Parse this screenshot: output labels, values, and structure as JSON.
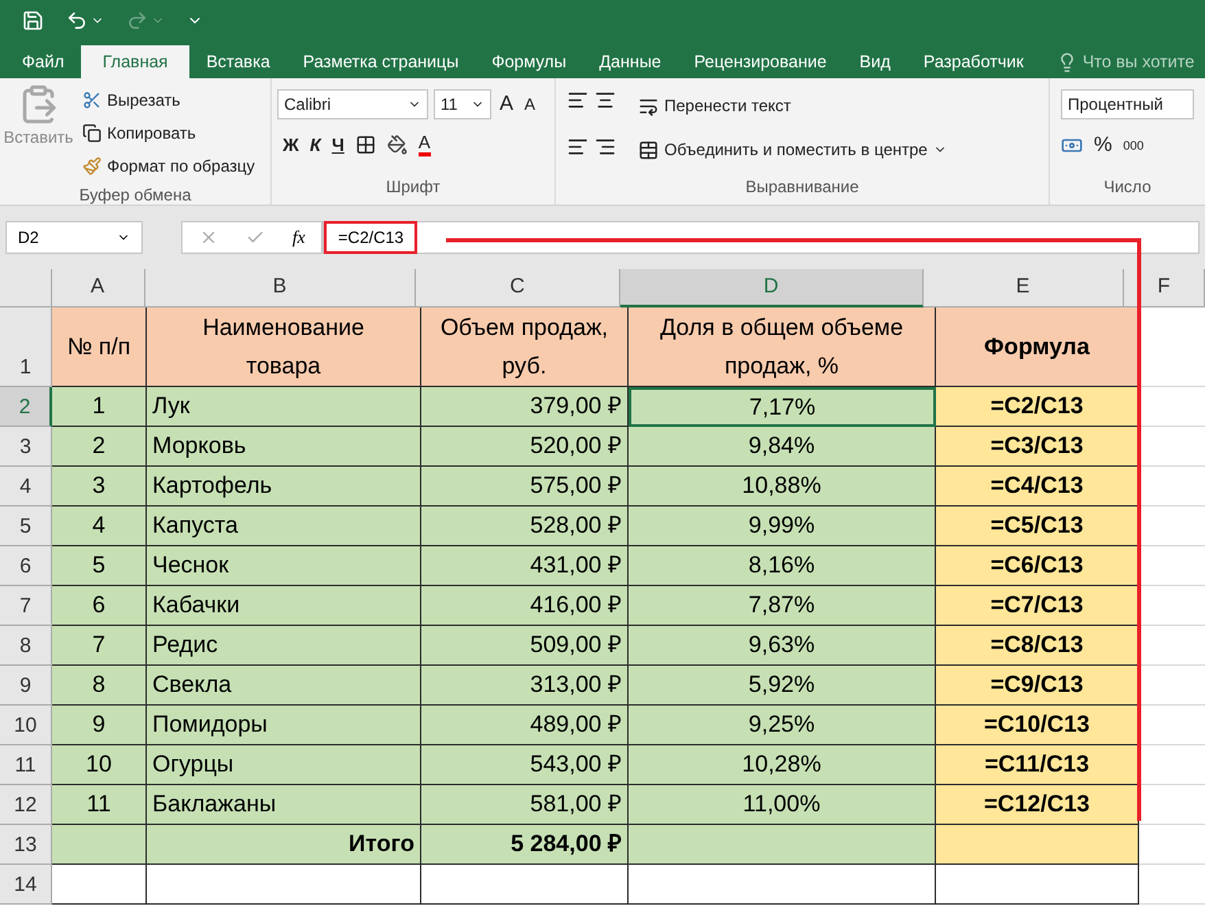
{
  "tabs": [
    {
      "label": "Файл",
      "selected": false
    },
    {
      "label": "Главная",
      "selected": true
    },
    {
      "label": "Вставка",
      "selected": false
    },
    {
      "label": "Разметка страницы",
      "selected": false
    },
    {
      "label": "Формулы",
      "selected": false
    },
    {
      "label": "Данные",
      "selected": false
    },
    {
      "label": "Рецензирование",
      "selected": false
    },
    {
      "label": "Вид",
      "selected": false
    },
    {
      "label": "Разработчик",
      "selected": false
    }
  ],
  "search_hint": "Что вы хотите",
  "clipboard": {
    "paste": "Вставить",
    "cut": "Вырезать",
    "copy": "Копировать",
    "format_painter": "Формат по образцу",
    "label": "Буфер обмена"
  },
  "font": {
    "name": "Calibri",
    "size": "11",
    "grow": "A",
    "shrink": "A",
    "bold": "Ж",
    "italic": "К",
    "underline": "Ч",
    "font_color": "A",
    "label": "Шрифт"
  },
  "alignment": {
    "wrap": "Перенести текст",
    "merge": "Объединить и поместить в центре",
    "label": "Выравнивание"
  },
  "number": {
    "format": "Процентный",
    "percent": "%",
    "thousands": "000",
    "label": "Число"
  },
  "formula_bar": {
    "name_box": "D2",
    "fx": "fx",
    "formula": "=C2/C13"
  },
  "sheet": {
    "columns": [
      {
        "label": "A",
        "selected": false
      },
      {
        "label": "B",
        "selected": false
      },
      {
        "label": "C",
        "selected": false
      },
      {
        "label": "D",
        "selected": true
      },
      {
        "label": "E",
        "selected": false
      },
      {
        "label": "F",
        "selected": false
      }
    ],
    "rows": [
      {
        "number": "1",
        "kind": "header",
        "selected": false,
        "cells": [
          "№ п/п",
          "Наименование товара",
          "Объем продаж, руб.",
          "Доля в общем объеме продаж, %",
          "Формула"
        ]
      },
      {
        "number": "2",
        "kind": "data",
        "selected": true,
        "cells": [
          "1",
          "Лук",
          "379,00 ₽",
          "7,17%",
          "=C2/C13"
        ]
      },
      {
        "number": "3",
        "kind": "data",
        "selected": false,
        "cells": [
          "2",
          "Морковь",
          "520,00 ₽",
          "9,84%",
          "=C3/C13"
        ]
      },
      {
        "number": "4",
        "kind": "data",
        "selected": false,
        "cells": [
          "3",
          "Картофель",
          "575,00 ₽",
          "10,88%",
          "=C4/C13"
        ]
      },
      {
        "number": "5",
        "kind": "data",
        "selected": false,
        "cells": [
          "4",
          "Капуста",
          "528,00 ₽",
          "9,99%",
          "=C5/C13"
        ]
      },
      {
        "number": "6",
        "kind": "data",
        "selected": false,
        "cells": [
          "5",
          "Чеснок",
          "431,00 ₽",
          "8,16%",
          "=C6/C13"
        ]
      },
      {
        "number": "7",
        "kind": "data",
        "selected": false,
        "cells": [
          "6",
          "Кабачки",
          "416,00 ₽",
          "7,87%",
          "=C7/C13"
        ]
      },
      {
        "number": "8",
        "kind": "data",
        "selected": false,
        "cells": [
          "7",
          "Редис",
          "509,00 ₽",
          "9,63%",
          "=C8/C13"
        ]
      },
      {
        "number": "9",
        "kind": "data",
        "selected": false,
        "cells": [
          "8",
          "Свекла",
          "313,00 ₽",
          "5,92%",
          "=C9/C13"
        ]
      },
      {
        "number": "10",
        "kind": "data",
        "selected": false,
        "cells": [
          "9",
          "Помидоры",
          "489,00 ₽",
          "9,25%",
          "=C10/C13"
        ]
      },
      {
        "number": "11",
        "kind": "data",
        "selected": false,
        "cells": [
          "10",
          "Огурцы",
          "543,00 ₽",
          "10,28%",
          "=C11/C13"
        ]
      },
      {
        "number": "12",
        "kind": "data",
        "selected": false,
        "cells": [
          "11",
          "Баклажаны",
          "581,00 ₽",
          "11,00%",
          "=C12/C13"
        ]
      },
      {
        "number": "13",
        "kind": "total",
        "selected": false,
        "cells": [
          "",
          "Итого",
          "5 284,00 ₽",
          "",
          ""
        ]
      },
      {
        "number": "14",
        "kind": "empty",
        "selected": false,
        "cells": [
          "",
          "",
          "",
          "",
          ""
        ]
      }
    ]
  }
}
